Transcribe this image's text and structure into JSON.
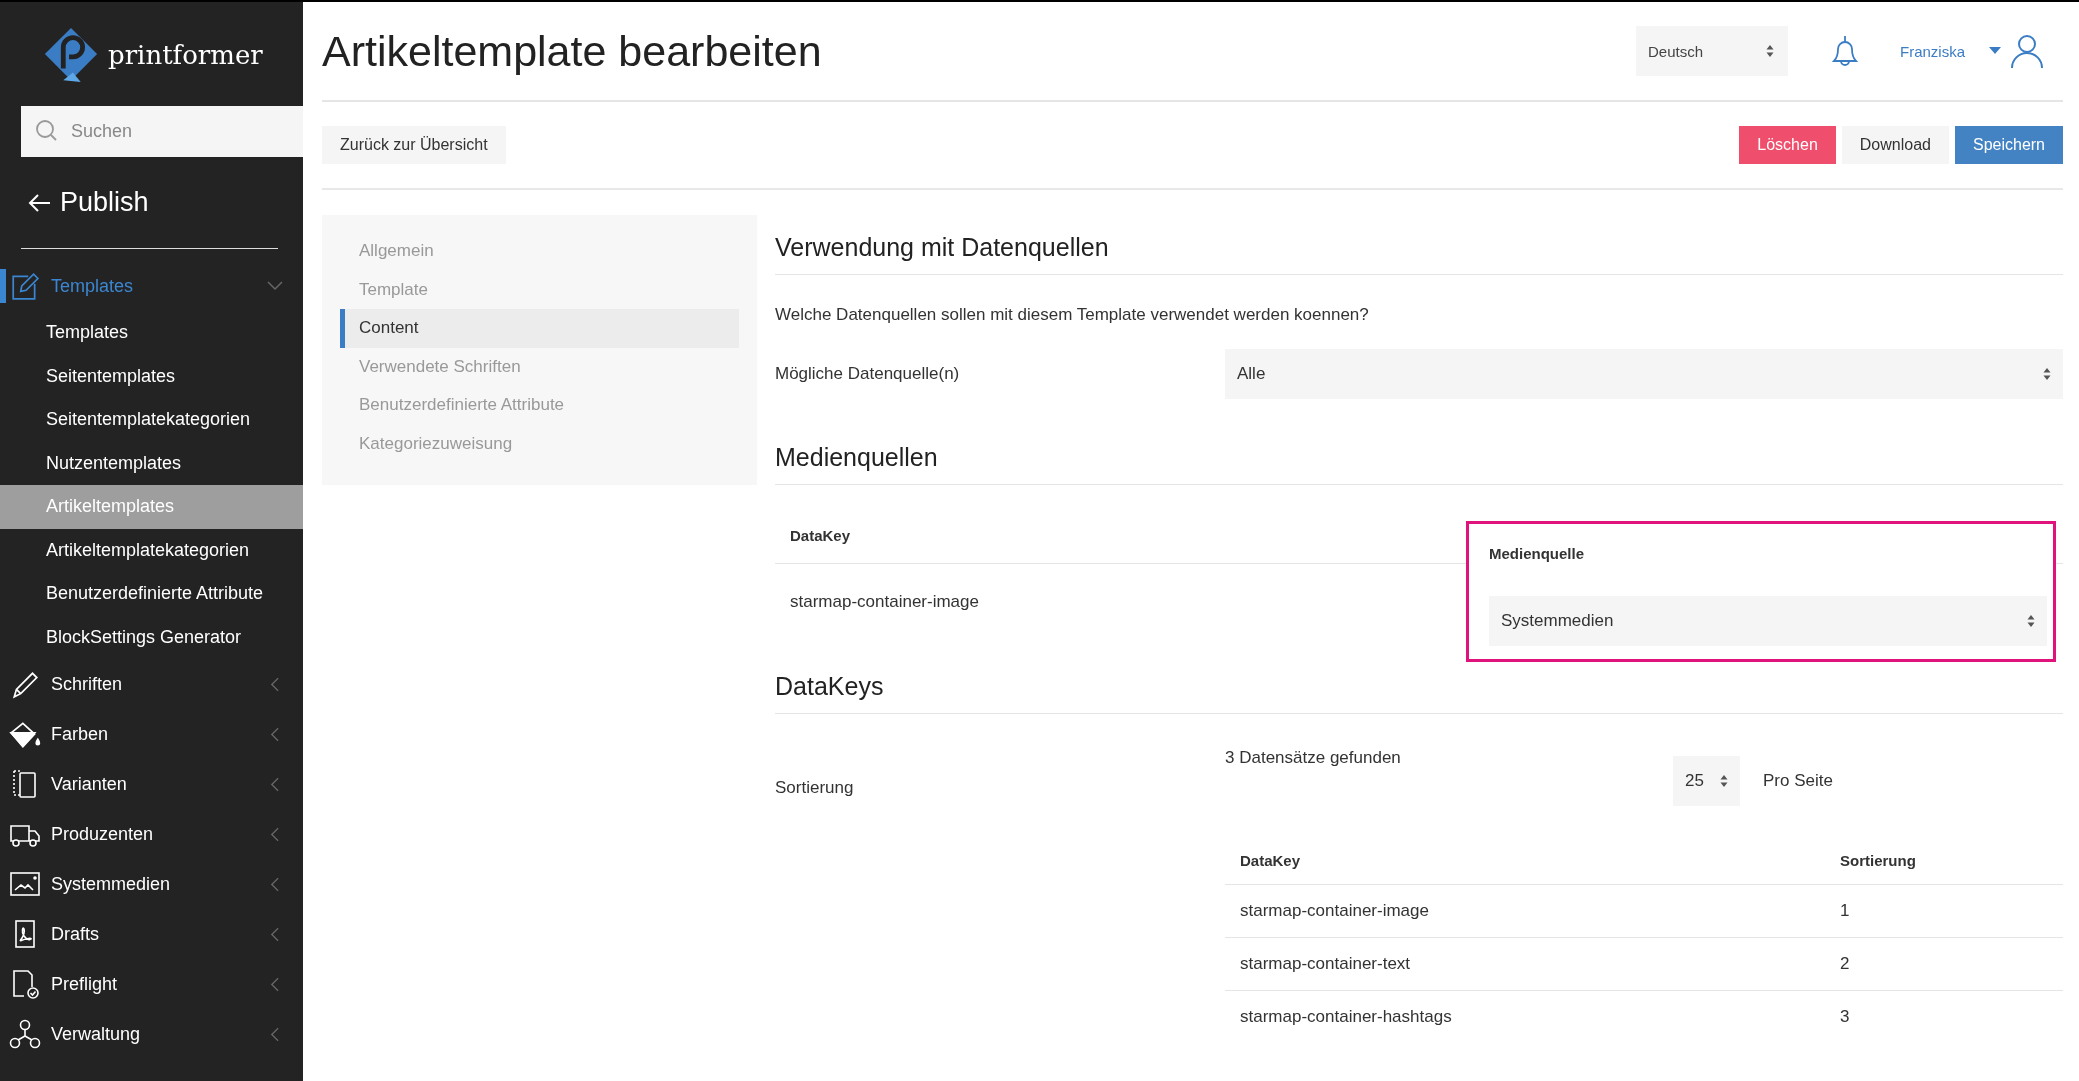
{
  "brand": "printformer",
  "sidebar": {
    "search": {
      "placeholder": "Suchen"
    },
    "back": "Publish",
    "items": [
      {
        "label": "Templates",
        "expanded": true,
        "selected": true,
        "children": [
          {
            "label": "Templates",
            "selected": false
          },
          {
            "label": "Seitentemplates",
            "selected": false
          },
          {
            "label": "Seitentemplatekategorien",
            "selected": false
          },
          {
            "label": "Nutzentemplates",
            "selected": false
          },
          {
            "label": "Artikeltemplates",
            "selected": true
          },
          {
            "label": "Artikeltemplatekategorien",
            "selected": false
          },
          {
            "label": "Benutzerdefinierte Attribute",
            "selected": false
          },
          {
            "label": "BlockSettings Generator",
            "selected": false
          }
        ]
      },
      {
        "label": "Schriften",
        "expanded": false,
        "selected": false
      },
      {
        "label": "Farben",
        "expanded": false,
        "selected": false
      },
      {
        "label": "Varianten",
        "expanded": false,
        "selected": false
      },
      {
        "label": "Produzenten",
        "expanded": false,
        "selected": false
      },
      {
        "label": "Systemmedien",
        "expanded": false,
        "selected": false
      },
      {
        "label": "Drafts",
        "expanded": false,
        "selected": false
      },
      {
        "label": "Preflight",
        "expanded": false,
        "selected": false
      },
      {
        "label": "Verwaltung",
        "expanded": false,
        "selected": false
      }
    ]
  },
  "header": {
    "title": "Artikeltemplate bearbeiten",
    "language": "Deutsch",
    "user": "Franziska"
  },
  "toolbar": {
    "back": "Zurück zur Übersicht",
    "buttons": [
      {
        "label": "Löschen",
        "kind": "danger"
      },
      {
        "label": "Download",
        "kind": "default"
      },
      {
        "label": "Speichern",
        "kind": "primary"
      }
    ]
  },
  "tabs": [
    {
      "label": "Allgemein",
      "selected": false
    },
    {
      "label": "Template",
      "selected": false
    },
    {
      "label": "Content",
      "selected": true
    },
    {
      "label": "Verwendete Schriften",
      "selected": false
    },
    {
      "label": "Benutzerdefinierte Attribute",
      "selected": false
    },
    {
      "label": "Kategoriezuweisung",
      "selected": false
    }
  ],
  "datasources": {
    "title": "Verwendung mit Datenquellen",
    "question": "Welche Datenquellen sollen mit diesem Template verwendet werden koennen?",
    "label": "Mögliche Datenquelle(n)",
    "value": "Alle"
  },
  "media": {
    "title": "Medienquellen",
    "columns": [
      "DataKey",
      "Medienquelle"
    ],
    "highlighted": true,
    "rows": [
      {
        "datakey": "starmap-container-image",
        "source": "Systemmedien"
      }
    ]
  },
  "datakeys": {
    "title": "DataKeys",
    "sort_label": "Sortierung",
    "count": "3 Datensätze gefunden",
    "per_page": "25",
    "per_page_label": "Pro Seite",
    "columns": [
      "DataKey",
      "Sortierung"
    ],
    "rows": [
      {
        "datakey": "starmap-container-image",
        "order": "1"
      },
      {
        "datakey": "starmap-container-text",
        "order": "2"
      },
      {
        "datakey": "starmap-container-hashtags",
        "order": "3"
      }
    ]
  }
}
